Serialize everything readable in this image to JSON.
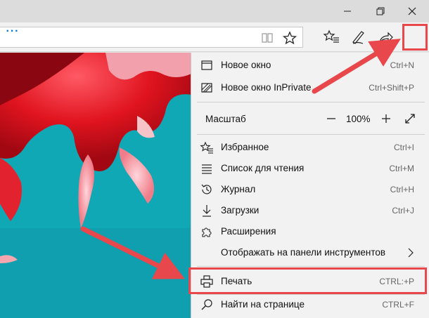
{
  "window": {
    "controls": {
      "minimize_icon": "minimize-icon",
      "maximize_icon": "restore-icon",
      "close_icon": "close-icon"
    }
  },
  "toolbar": {
    "more_label": "···"
  },
  "menu": {
    "new_window": {
      "label": "Новое окно",
      "shortcut": "Ctrl+N",
      "icon": "window-icon"
    },
    "new_inprivate": {
      "label": "Новое окно InPrivate",
      "shortcut": "Ctrl+Shift+P",
      "icon": "inprivate-icon"
    },
    "zoom": {
      "label": "Масштаб",
      "value": "100%"
    },
    "favorites": {
      "label": "Избранное",
      "shortcut": "Ctrl+I",
      "icon": "favorites-icon"
    },
    "reading_list": {
      "label": "Список для чтения",
      "shortcut": "Ctrl+M",
      "icon": "reading-list-icon"
    },
    "history": {
      "label": "Журнал",
      "shortcut": "Ctrl+H",
      "icon": "history-icon"
    },
    "downloads": {
      "label": "Загрузки",
      "shortcut": "Ctrl+J",
      "icon": "download-icon"
    },
    "extensions": {
      "label": "Расширения",
      "icon": "extensions-icon"
    },
    "show_in_toolbar": {
      "label": "Отображать на панели инструментов"
    },
    "print": {
      "label": "Печать",
      "shortcut": "CTRL:+P",
      "icon": "print-icon"
    },
    "find": {
      "label": "Найти на странице",
      "shortcut": "CTRL+F",
      "icon": "search-icon"
    }
  },
  "colors": {
    "accent": "#0078d7",
    "annotation": "#e8474c",
    "content_teal": "#0fa9b3",
    "content_red": "#d9121d"
  }
}
